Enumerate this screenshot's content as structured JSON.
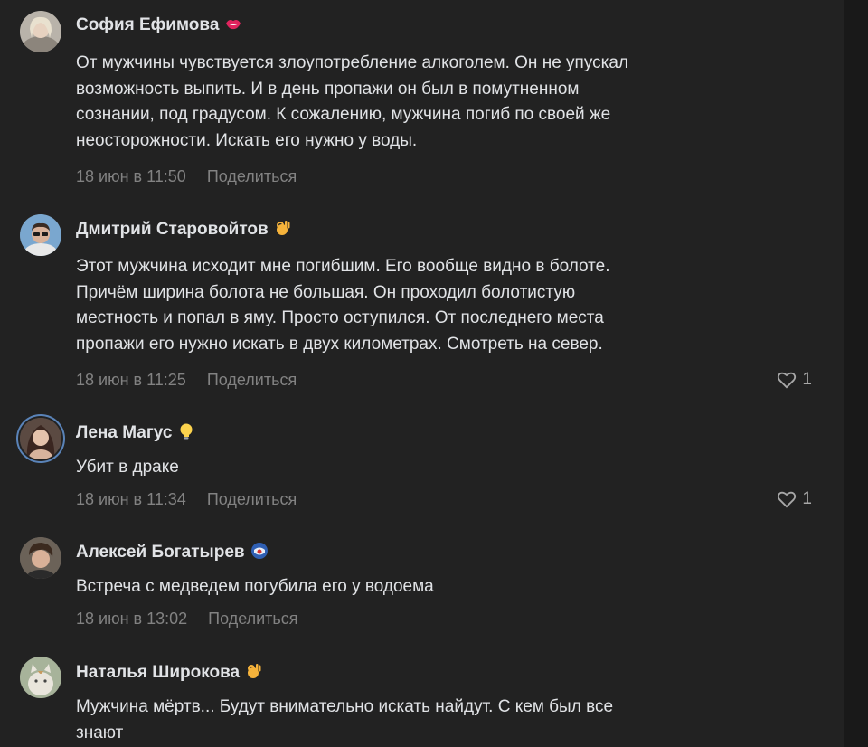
{
  "comments": [
    {
      "author": "София Ефимова",
      "badge_icon": "lips-icon",
      "lines": [
        "От мужчины чувствуется злоупотребление алкоголем. Он не упускал",
        "возможность выпить. И в день пропажи он был в помутненном",
        "сознании, под градусом. К сожалению, мужчина погиб по своей же",
        "неосторожности. Искать его нужно у воды."
      ],
      "date": "18 июн в 11:50",
      "share": "Поделиться",
      "likes": ""
    },
    {
      "author": "Дмитрий Старовойтов",
      "badge_icon": "ok-hand-icon",
      "lines": [
        "Этот мужчина исходит мне погибшим. Его вообще видно в болоте.",
        "Причём ширина болота не большая. Он проходил болотистую",
        "местность и попал в яму. Просто оступился. От последнего места",
        "пропажи его нужно искать в двух километрах. Смотреть на север."
      ],
      "date": "18 июн в 11:25",
      "share": "Поделиться",
      "likes": "1"
    },
    {
      "author": "Лена Магус",
      "badge_icon": "lightbulb-icon",
      "lines": [
        "Убит в драке"
      ],
      "date": "18 июн в 11:34",
      "share": "Поделиться",
      "likes": "1"
    },
    {
      "author": "Алексей Богатырев",
      "badge_icon": "captain-shield-icon",
      "lines": [
        "Встреча с медведем погубила его у водоема"
      ],
      "date": "18 июн в 13:02",
      "share": "Поделиться",
      "likes": ""
    },
    {
      "author": "Наталья Широкова",
      "badge_icon": "ok-hand-icon",
      "lines": [
        "Мужчина мёртв... Будут внимательно искать найдут. С кем был все",
        "знают"
      ],
      "date": "",
      "share": "",
      "likes": ""
    }
  ],
  "colors": {
    "background": "#222222",
    "text": "#e1e3e6",
    "meta": "#828282",
    "avatar_ring": "#5a83b8"
  }
}
